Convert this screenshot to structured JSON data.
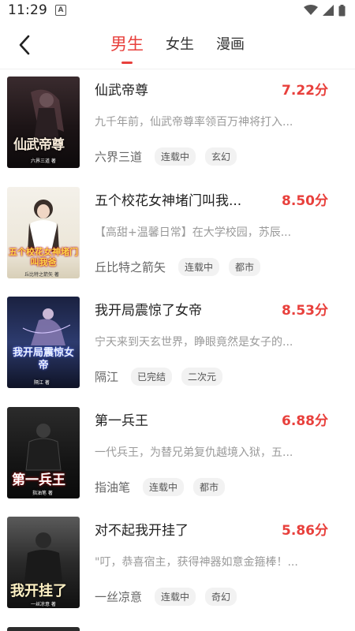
{
  "status": {
    "time": "11:29"
  },
  "nav": {
    "tabs": [
      {
        "label": "男生",
        "active": true
      },
      {
        "label": "女生",
        "active": false
      },
      {
        "label": "漫画",
        "active": false
      }
    ]
  },
  "colors": {
    "accent": "#e8403c"
  },
  "books": [
    {
      "title": "仙武帝尊",
      "score": "7.22分",
      "desc": "九千年前，仙武帝尊率领百万神将打入...",
      "author": "六界三道",
      "status": "连载中",
      "genre": "玄幻",
      "cover": {
        "title": "仙武帝尊",
        "author": "六界三道 著"
      }
    },
    {
      "title": "五个校花女神堵门叫我...",
      "score": "8.50分",
      "desc": "【高甜+温馨日常】在大学校园，苏辰...",
      "author": "丘比特之箭矢",
      "status": "连载中",
      "genre": "都市",
      "cover": {
        "title": "五个校花女神堵门叫我爸",
        "author": "丘比特之箭矢 著"
      }
    },
    {
      "title": "我开局震惊了女帝",
      "score": "8.53分",
      "desc": "宁天来到天玄世界，睁眼竟然是女子的...",
      "author": "隔江",
      "status": "已完结",
      "genre": "二次元",
      "cover": {
        "title": "我开局震惊女帝",
        "author": "隔江 著"
      }
    },
    {
      "title": "第一兵王",
      "score": "6.88分",
      "desc": "一代兵王，为替兄弟复仇越境入狱，五...",
      "author": "指油笔",
      "status": "连载中",
      "genre": "都市",
      "cover": {
        "title": "第一兵王",
        "author": "指油笔 著"
      }
    },
    {
      "title": "对不起我开挂了",
      "score": "5.86分",
      "desc": "\"叮，恭喜宿主，获得神器如意金箍棒！...",
      "author": "一丝凉意",
      "status": "连载中",
      "genre": "奇幻",
      "cover": {
        "title": "我开挂了",
        "author": "一丝凉意 著"
      }
    }
  ]
}
